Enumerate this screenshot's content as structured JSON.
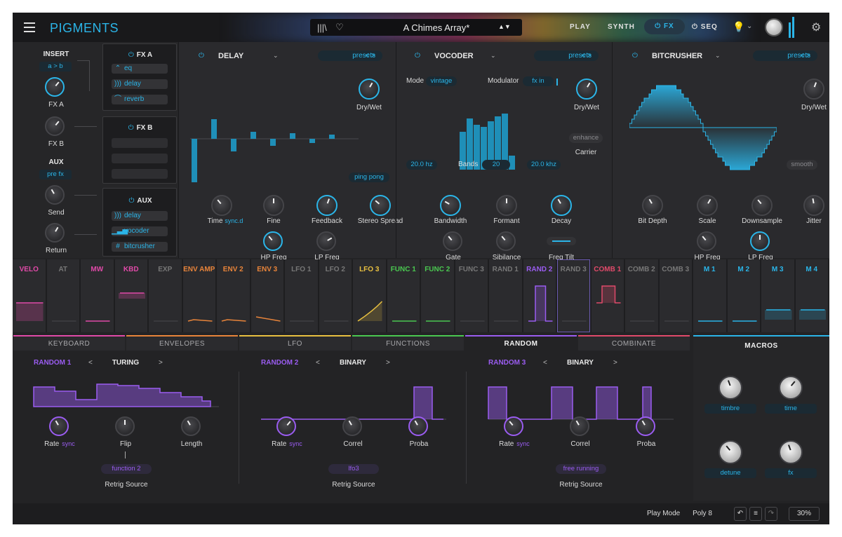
{
  "app": {
    "title": "PIGMENTS",
    "preset_name": "A Chimes Array*",
    "accent": "#2bb5e8",
    "purple": "#9a5cf0"
  },
  "nav": {
    "play": "PLAY",
    "synth": "SYNTH",
    "fx": "FX",
    "seq": "SEQ"
  },
  "routing": {
    "insert": "INSERT",
    "insert_mode": "a > b",
    "fx_a": "FX A",
    "fx_b": "FX B",
    "aux": "AUX",
    "aux_mode": "pre fx",
    "send": "Send",
    "return": "Return"
  },
  "fx_a_slot": {
    "title": "FX A",
    "items": [
      "eq",
      "delay",
      "reverb"
    ]
  },
  "fx_b_slot": {
    "title": "FX B"
  },
  "aux_slot": {
    "title": "AUX",
    "items": [
      "delay",
      "vocoder",
      "bitcrusher"
    ]
  },
  "delay": {
    "title": "DELAY",
    "presets": "presets",
    "drywet": "Dry/Wet",
    "pingpong": "ping pong",
    "time": "Time",
    "sync": "sync.d",
    "fine": "Fine",
    "feedback": "Feedback",
    "stereo_spread": "Stereo Spread",
    "hp_freq": "HP Freq",
    "lp_freq": "LP Freq"
  },
  "vocoder": {
    "title": "VOCODER",
    "presets": "presets",
    "mode_label": "Mode",
    "mode_value": "vintage",
    "modulator_label": "Modulator",
    "modulator_value": "fx in",
    "drywet": "Dry/Wet",
    "enhance": "enhance",
    "carrier": "Carrier",
    "low": "20.0 hz",
    "bands_label": "Bands",
    "bands_value": "20",
    "high": "20.0 khz",
    "bandwidth": "Bandwidth",
    "formant": "Formant",
    "decay": "Decay",
    "gate": "Gate",
    "sibilance": "Sibilance",
    "freq_tilt": "Freq Tilt",
    "band_levels": [
      0.55,
      0.75,
      0.65,
      0.62,
      0.7,
      0.78,
      0.82,
      0.2
    ]
  },
  "bitcrusher": {
    "title": "BITCRUSHER",
    "presets": "presets",
    "drywet": "Dry/Wet",
    "smooth": "smooth",
    "bit_depth": "Bit Depth",
    "scale": "Scale",
    "downsample": "Downsample",
    "jitter": "Jitter",
    "hp_freq": "HP Freq",
    "lp_freq": "LP Freq"
  },
  "mod_sources": [
    {
      "label": "VELO",
      "color": "#e04aa8"
    },
    {
      "label": "AT",
      "color": "#777777"
    },
    {
      "label": "MW",
      "color": "#e04aa8"
    },
    {
      "label": "KBD",
      "color": "#e04aa8"
    },
    {
      "label": "EXP",
      "color": "#777777"
    },
    {
      "label": "ENV AMP",
      "color": "#e8843a"
    },
    {
      "label": "ENV 2",
      "color": "#e8843a"
    },
    {
      "label": "ENV 3",
      "color": "#e8843a"
    },
    {
      "label": "LFO 1",
      "color": "#777777"
    },
    {
      "label": "LFO 2",
      "color": "#777777"
    },
    {
      "label": "LFO 3",
      "color": "#e8c040"
    },
    {
      "label": "FUNC 1",
      "color": "#4ac850"
    },
    {
      "label": "FUNC 2",
      "color": "#4ac850"
    },
    {
      "label": "FUNC 3",
      "color": "#777777"
    },
    {
      "label": "RAND 1",
      "color": "#777777"
    },
    {
      "label": "RAND 2",
      "color": "#9a5cf0"
    },
    {
      "label": "RAND 3",
      "color": "#777777"
    },
    {
      "label": "COMB 1",
      "color": "#e04a6a"
    },
    {
      "label": "COMB 2",
      "color": "#777777"
    },
    {
      "label": "COMB 3",
      "color": "#777777"
    },
    {
      "label": "M 1",
      "color": "#2bb5e8"
    },
    {
      "label": "M 2",
      "color": "#2bb5e8"
    },
    {
      "label": "M 3",
      "color": "#2bb5e8"
    },
    {
      "label": "M 4",
      "color": "#2bb5e8"
    }
  ],
  "tabs": [
    {
      "label": "KEYBOARD",
      "color": "#e04aa8"
    },
    {
      "label": "ENVELOPES",
      "color": "#e8843a"
    },
    {
      "label": "LFO",
      "color": "#e8c040"
    },
    {
      "label": "FUNCTIONS",
      "color": "#4ac850"
    },
    {
      "label": "RANDOM",
      "color": "#9a5cf0"
    },
    {
      "label": "COMBINATE",
      "color": "#e04a6a"
    }
  ],
  "random": [
    {
      "title": "RANDOM 1",
      "mode": "TURING",
      "k1": "Rate",
      "k2": "Flip",
      "k3": "Length",
      "source": "function 2",
      "retrig": "Retrig Source"
    },
    {
      "title": "RANDOM 2",
      "mode": "BINARY",
      "k1": "Rate",
      "k2": "Correl",
      "k3": "Proba",
      "source": "lfo3",
      "retrig": "Retrig Source"
    },
    {
      "title": "RANDOM 3",
      "mode": "BINARY",
      "k1": "Rate",
      "k2": "Correl",
      "k3": "Proba",
      "source": "free running",
      "retrig": "Retrig Source"
    }
  ],
  "sync": "sync",
  "macros": {
    "title": "MACROS",
    "names": [
      "timbre",
      "time",
      "detune",
      "fx"
    ]
  },
  "footer": {
    "play_mode_label": "Play Mode",
    "play_mode_value": "Poly 8",
    "zoom": "30%"
  }
}
